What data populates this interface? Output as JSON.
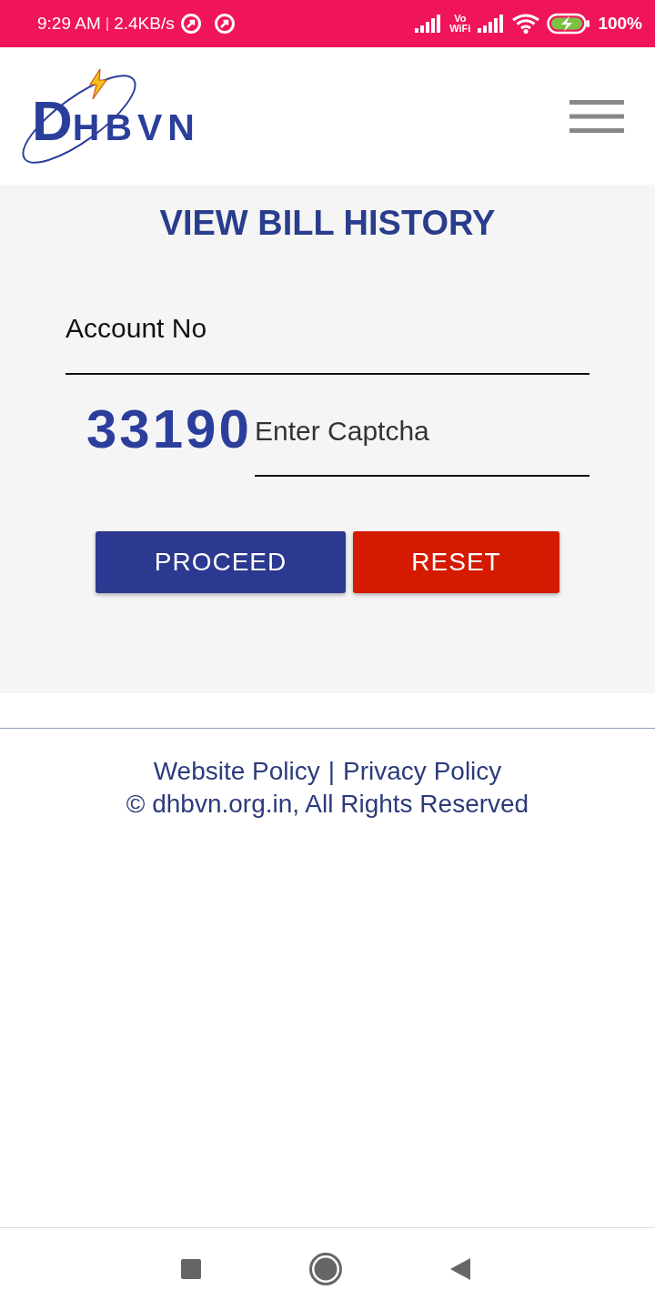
{
  "status_bar": {
    "time": "9:29 AM",
    "separator": "|",
    "speed": "2.4KB/s",
    "vowifi": [
      "Vo",
      "WiFi"
    ],
    "battery": "100%"
  },
  "header": {
    "logo": {
      "initial": "D",
      "text": "HBVN"
    }
  },
  "form": {
    "title": "VIEW BILL HISTORY",
    "account_field": {
      "placeholder": "Account No"
    },
    "captcha": {
      "code": "33190"
    },
    "captcha_field": {
      "placeholder": "Enter Captcha"
    },
    "buttons": [
      {
        "label": "PROCEED",
        "kind": "primary"
      },
      {
        "label": "RESET",
        "kind": "danger"
      }
    ]
  },
  "footer": {
    "links": [
      "Website Policy",
      "Privacy Policy"
    ],
    "separator": "|",
    "copyright": "© dhbvn.org.in, All Rights Reserved"
  }
}
